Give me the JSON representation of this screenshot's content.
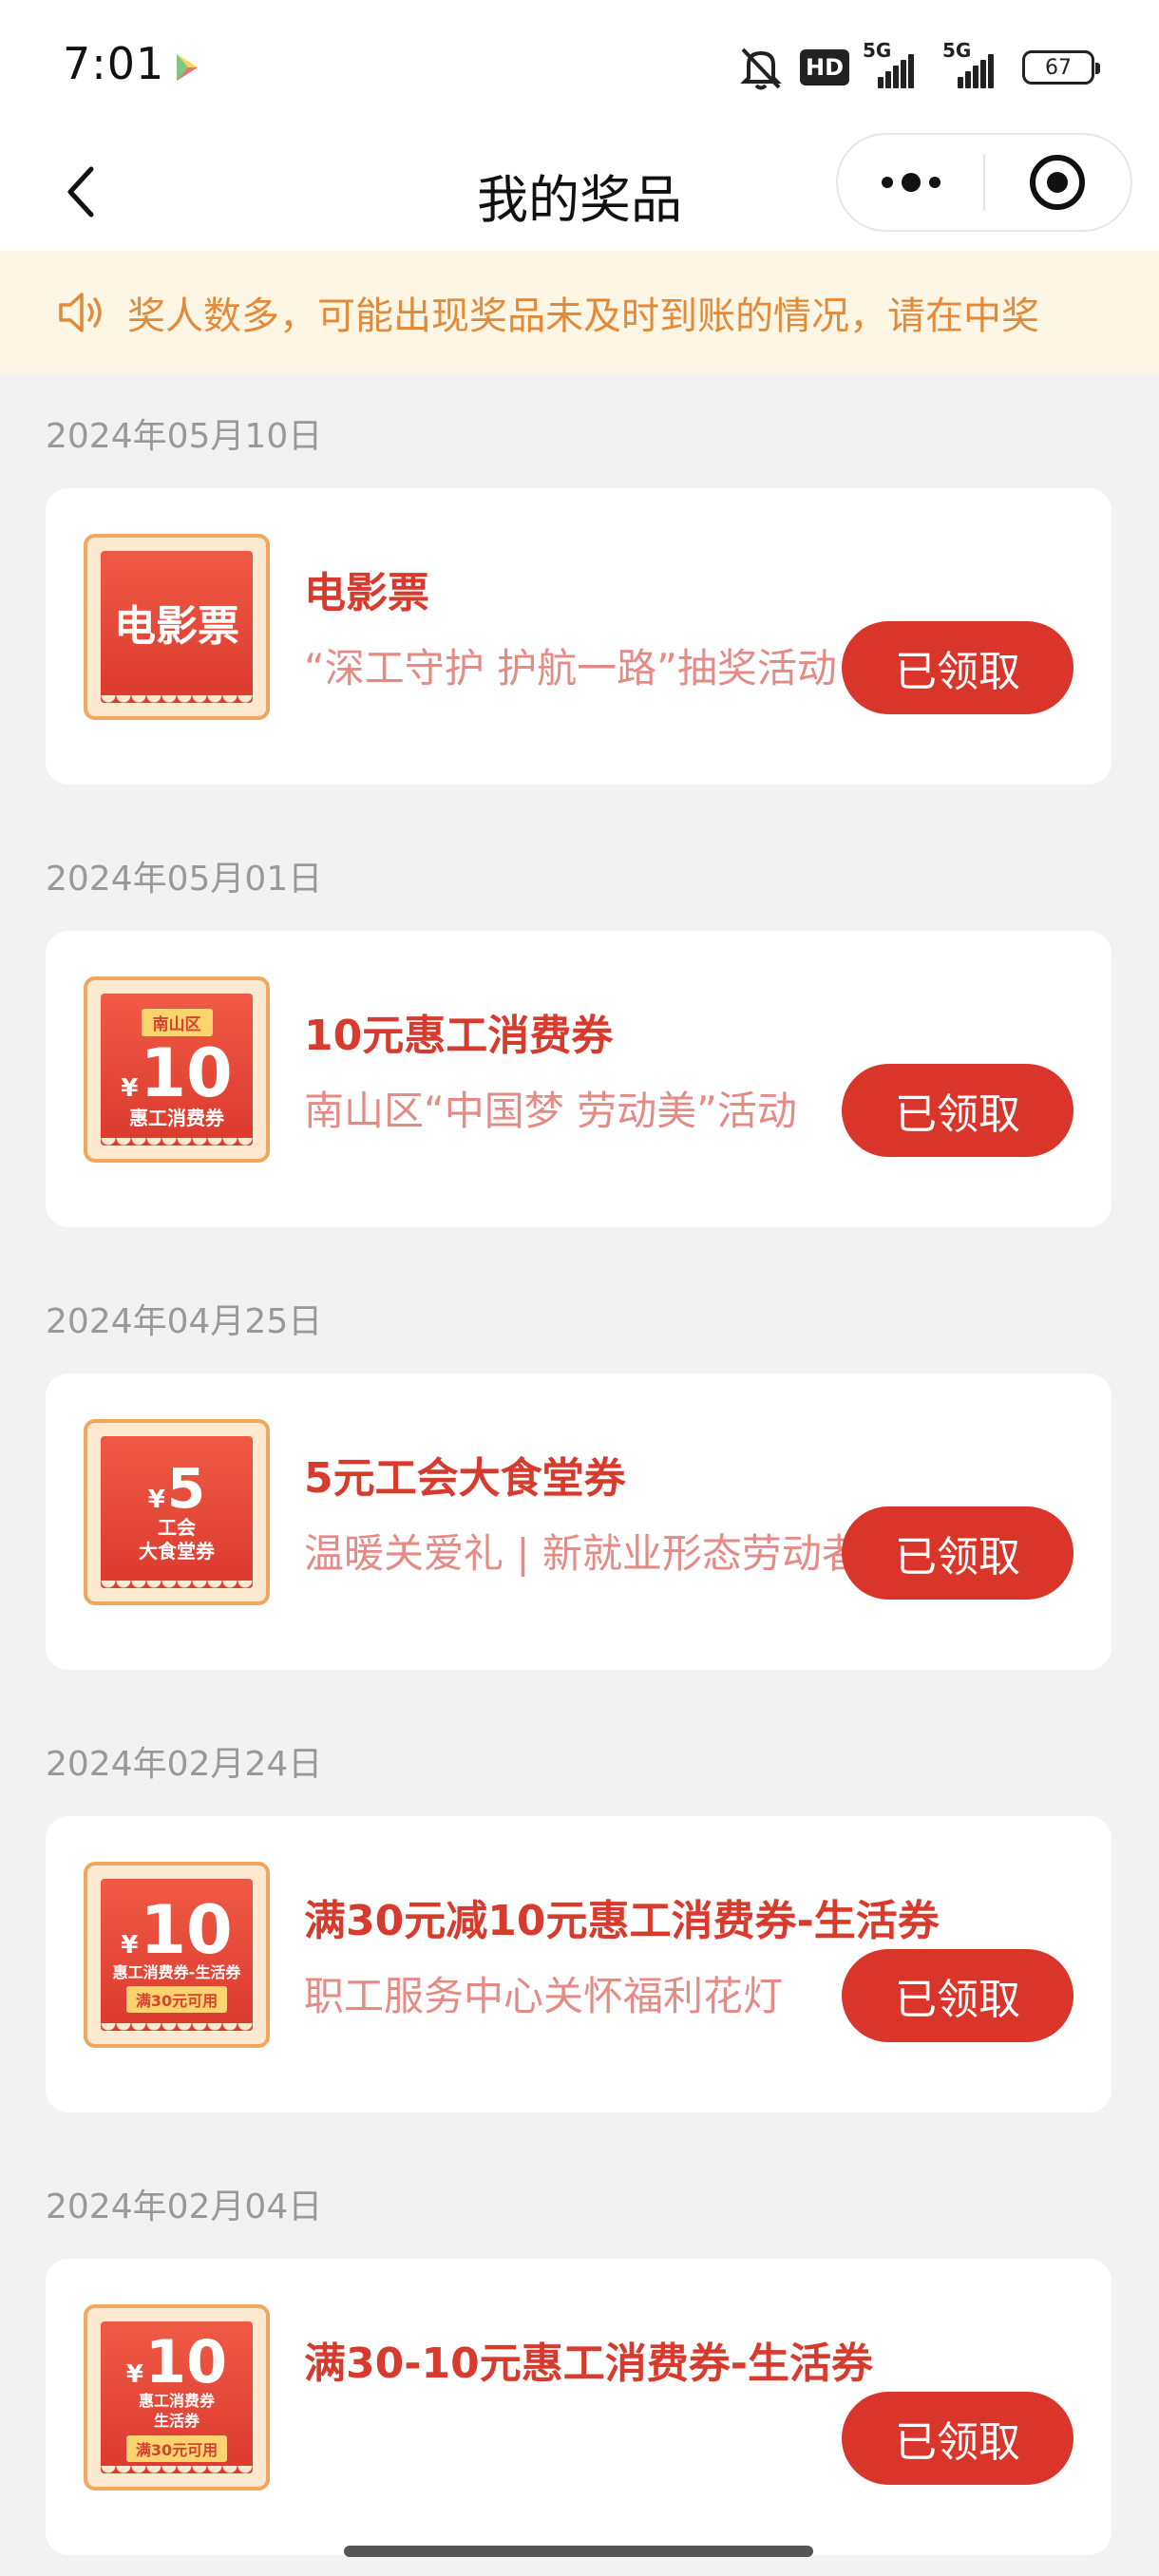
{
  "status_bar": {
    "time": "7:01",
    "hd_label": "HD",
    "net1": "5G",
    "net2": "5G",
    "battery": "67"
  },
  "nav": {
    "title": "我的奖品"
  },
  "notice": {
    "text": "奖人数多，可能出现奖品未及时到账的情况，请在中奖"
  },
  "prizes": [
    {
      "date": "2024年05月10日",
      "title": "电影票",
      "desc": "“深工守护 护航一路”抽奖活动",
      "button": "已领取",
      "thumb": {
        "main": "电影票"
      }
    },
    {
      "date": "2024年05月01日",
      "title": "10元惠工消费券",
      "desc": "南山区“中国梦 劳动美”活动",
      "button": "已领取",
      "thumb": {
        "top_tag": "南山区",
        "yen": "¥",
        "amount": "10",
        "line1": "惠工消费券"
      }
    },
    {
      "date": "2024年04月25日",
      "title": "5元工会大食堂券",
      "desc": "温暖关爱礼 | 新就业形态劳动者",
      "button": "已领取",
      "thumb": {
        "yen": "¥",
        "amount": "5",
        "line1": "工会",
        "line2": "大食堂券"
      }
    },
    {
      "date": "2024年02月24日",
      "title": "满30元减10元惠工消费券-生活券",
      "desc": "职工服务中心关怀福利花灯",
      "button": "已领取",
      "thumb": {
        "yen": "¥",
        "amount": "10",
        "line1": "惠工消费券-生活券",
        "tag": "满30元可用"
      }
    },
    {
      "date": "2024年02月04日",
      "title": "满30-10元惠工消费券-生活券",
      "desc": "",
      "button": "已领取",
      "thumb": {
        "yen": "¥",
        "amount": "10",
        "line1": "惠工消费券",
        "line2": "生活券",
        "tag": "满30元可用"
      }
    }
  ],
  "colors": {
    "accent": "#d9352b",
    "title_red": "#d63b2e",
    "desc_pink": "#e58b86",
    "notice_bg": "#fdf6e4",
    "notice_text": "#e08a3a"
  }
}
